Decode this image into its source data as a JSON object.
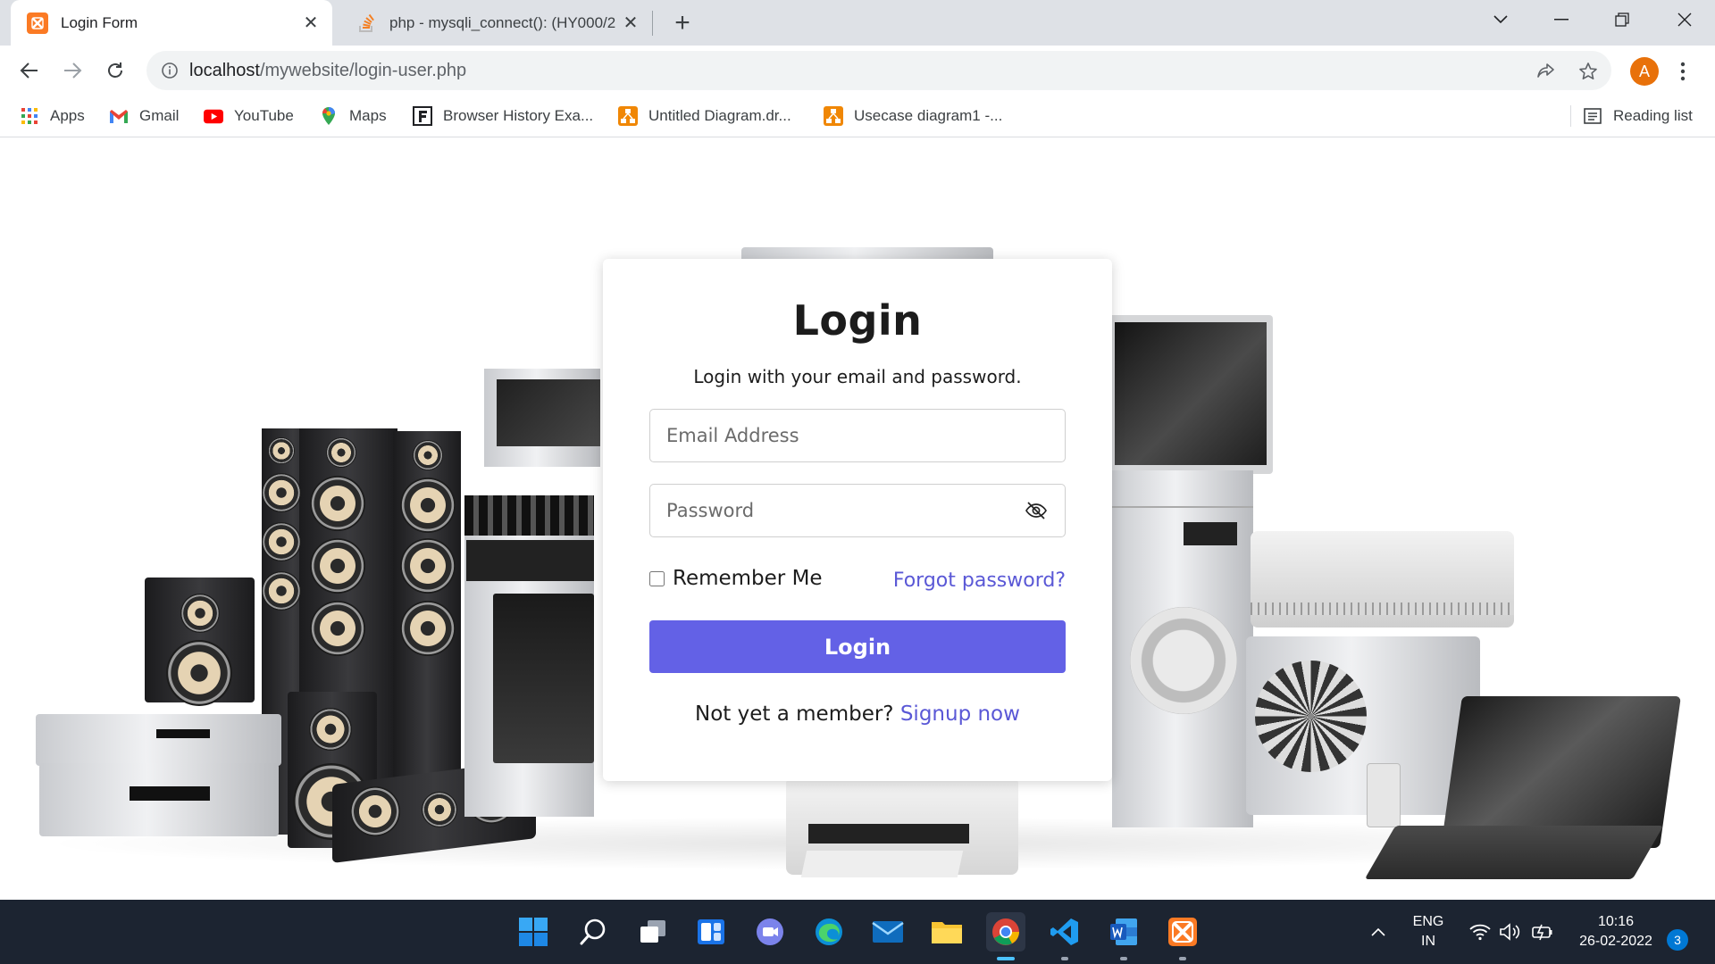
{
  "browser": {
    "tabs": [
      {
        "title": "Login Form",
        "active": true,
        "icon": "xampp-icon"
      },
      {
        "title": "php - mysqli_connect(): (HY000/2",
        "active": false,
        "icon": "stackoverflow-icon"
      }
    ],
    "url": {
      "host": "localhost",
      "path": "/mywebsite/login-user.php"
    },
    "profile_initial": "A",
    "bookmarks": [
      {
        "label": "Apps",
        "icon": "apps-grid-icon"
      },
      {
        "label": "Gmail",
        "icon": "gmail-icon"
      },
      {
        "label": "YouTube",
        "icon": "youtube-icon"
      },
      {
        "label": "Maps",
        "icon": "maps-icon"
      },
      {
        "label": "Browser History Exa...",
        "icon": "f-icon"
      },
      {
        "label": "Untitled Diagram.dr...",
        "icon": "drawio-icon"
      },
      {
        "label": "Usecase diagram1 -...",
        "icon": "drawio-icon"
      }
    ],
    "reading_list": "Reading list"
  },
  "login": {
    "title": "Login",
    "subtitle": "Login with your email and password.",
    "email_placeholder": "Email Address",
    "password_placeholder": "Password",
    "remember_label": "Remember Me",
    "forgot_label": "Forgot password?",
    "submit_label": "Login",
    "signup_prompt": "Not yet a member?",
    "signup_link": "Signup now"
  },
  "taskbar": {
    "language": "ENG",
    "region": "IN",
    "time": "10:16",
    "date": "26-02-2022",
    "notifications": "3"
  },
  "colors": {
    "accent": "#6361e6",
    "link": "#5a58d6",
    "taskbar": "#1c2431"
  }
}
